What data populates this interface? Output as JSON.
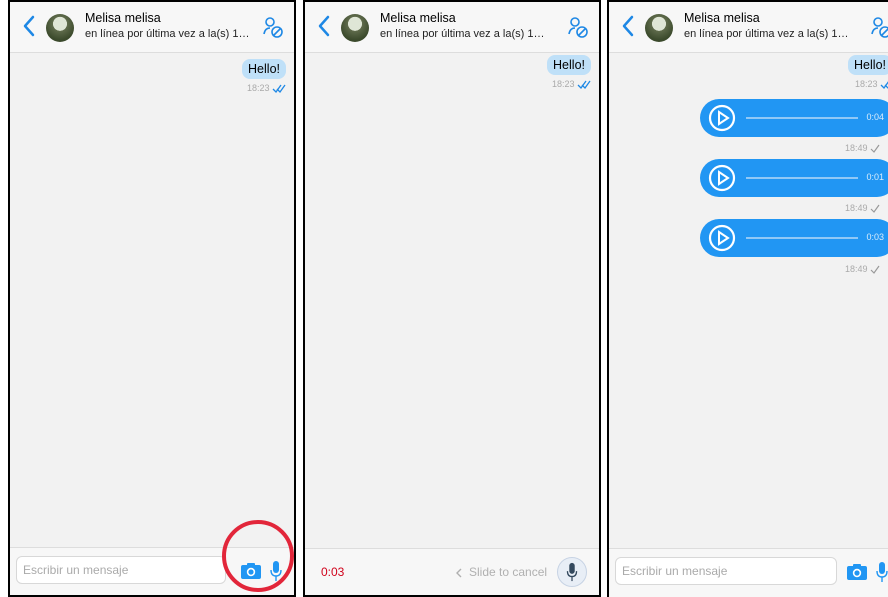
{
  "contact": {
    "name": "Melisa  melisa",
    "status": "en línea por última vez a la(s) 1…"
  },
  "messages": {
    "hello": {
      "text": "Hello!",
      "time": "18:23"
    },
    "voice": [
      {
        "duration": "0:04",
        "time": "18:49"
      },
      {
        "duration": "0:01",
        "time": "18:49"
      },
      {
        "duration": "0:03",
        "time": "18:49"
      }
    ]
  },
  "composer": {
    "placeholder": "Escribir un mensaje"
  },
  "recording": {
    "timer": "0:03",
    "slide_hint": "Slide to cancel"
  },
  "colors": {
    "accent": "#2196f3",
    "bubble_out": "#bfe0f8",
    "recording_timer": "#d0021b",
    "highlight_circle": "#e2263a"
  },
  "icons": [
    "chevron-left-icon",
    "avatar",
    "contact-block-icon",
    "camera-icon",
    "microphone-icon",
    "play-icon",
    "double-check-icon",
    "single-check-icon"
  ]
}
